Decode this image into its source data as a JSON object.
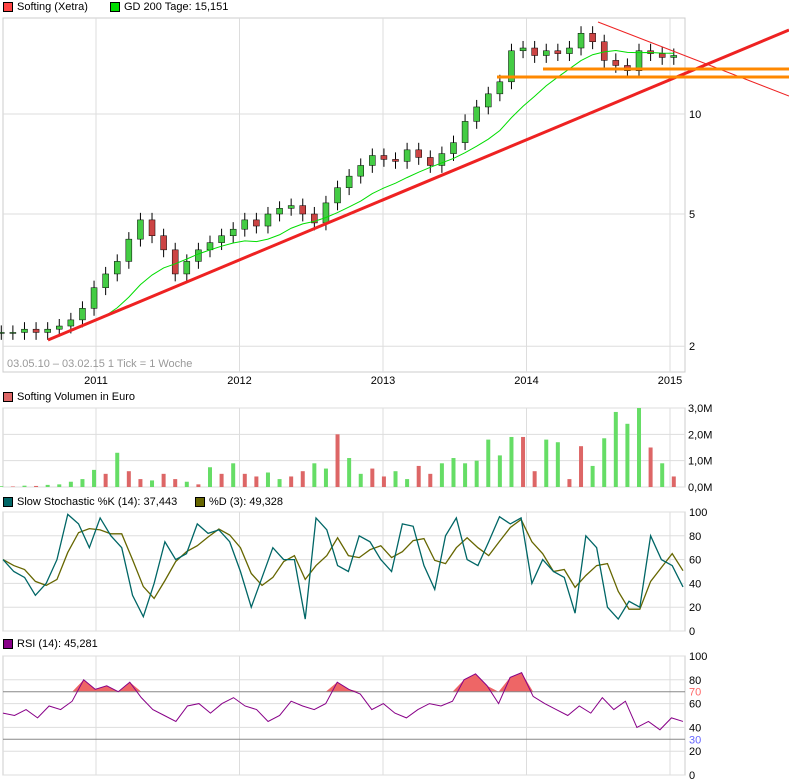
{
  "chart_data": [
    {
      "type": "candlestick",
      "name": "price",
      "legend": [
        {
          "label": "Softing (Xetra)",
          "color": "#ff4444"
        },
        {
          "label": "GD 200 Tage: 15,151",
          "color": "#00dd00"
        }
      ],
      "info": "03.05.10 – 03.02.15   1 Tick = 1 Woche",
      "yscale": "log",
      "ylim": [
        1.75,
        19.5
      ],
      "yticks": [
        {
          "v": 2,
          "l": "2"
        },
        {
          "v": 5,
          "l": "5"
        },
        {
          "v": 10,
          "l": "10"
        }
      ],
      "xticks": [
        {
          "v": 2011,
          "l": "2011"
        },
        {
          "v": 2012,
          "l": "2012"
        },
        {
          "v": 2013,
          "l": "2013"
        },
        {
          "v": 2014,
          "l": "2014"
        },
        {
          "v": 2015,
          "l": "2015"
        }
      ],
      "x_start": 2010.34,
      "x_step": 0.0808,
      "close": [
        2.2,
        2.2,
        2.25,
        2.2,
        2.25,
        2.3,
        2.4,
        2.6,
        3.0,
        3.3,
        3.6,
        4.2,
        4.8,
        4.3,
        3.9,
        3.3,
        3.6,
        3.9,
        4.1,
        4.3,
        4.5,
        4.8,
        4.6,
        5.0,
        5.2,
        5.3,
        5.0,
        4.7,
        5.4,
        6.0,
        6.5,
        7.0,
        7.5,
        7.3,
        7.2,
        7.8,
        7.4,
        7.0,
        7.6,
        8.2,
        9.5,
        10.5,
        11.5,
        12.5,
        15.5,
        15.8,
        15.0,
        15.5,
        15.2,
        15.8,
        17.5,
        16.5,
        14.5,
        14.0,
        13.5,
        15.5,
        15.2,
        14.8,
        15.0
      ],
      "ma_color": "#00dd00"
    },
    {
      "type": "bar",
      "name": "volume",
      "legend": [
        {
          "label": "Softing Volumen in Euro",
          "color": "#dd6666"
        }
      ],
      "ylim": [
        0,
        3
      ],
      "yticks": [
        {
          "v": 0,
          "l": "0,0M"
        },
        {
          "v": 1,
          "l": "1,0M"
        },
        {
          "v": 2,
          "l": "2,0M"
        },
        {
          "v": 3,
          "l": "3,0M"
        }
      ],
      "values": [
        0.03,
        0.02,
        0.05,
        0.04,
        0.08,
        0.1,
        0.2,
        0.3,
        0.65,
        0.5,
        1.3,
        0.6,
        0.3,
        0.25,
        0.5,
        0.3,
        0.2,
        0.1,
        0.75,
        0.5,
        0.9,
        0.5,
        0.4,
        0.55,
        0.3,
        0.4,
        0.6,
        0.9,
        0.7,
        2.0,
        1.1,
        0.5,
        0.7,
        0.4,
        0.6,
        0.3,
        0.8,
        0.5,
        0.9,
        1.1,
        0.9,
        1.0,
        1.8,
        1.2,
        1.9,
        1.9,
        0.6,
        1.8,
        1.7,
        0.3,
        1.55,
        0.8,
        1.85,
        2.85,
        2.4,
        3.0,
        1.5,
        0.9,
        0.4
      ],
      "up": [
        1,
        0,
        1,
        0,
        1,
        1,
        1,
        1,
        1,
        0,
        1,
        0,
        0,
        1,
        0,
        0,
        1,
        0,
        1,
        0,
        1,
        0,
        0,
        1,
        1,
        0,
        0,
        1,
        1,
        0,
        1,
        1,
        0,
        0,
        1,
        1,
        0,
        0,
        1,
        1,
        1,
        1,
        1,
        1,
        1,
        0,
        0,
        1,
        1,
        0,
        0,
        1,
        1,
        1,
        1,
        1,
        0,
        1,
        0
      ],
      "up_color": "#66dd66",
      "down_color": "#dd6666"
    },
    {
      "type": "line",
      "name": "stochastic",
      "legend": [
        {
          "label": "Slow Stochastic %K (14): 37,443",
          "color": "#006666"
        },
        {
          "label": "%D (3): 49,328",
          "color": "#666600"
        }
      ],
      "ylim": [
        0,
        100
      ],
      "yticks": [
        {
          "v": 0,
          "l": "0"
        },
        {
          "v": 20,
          "l": "20"
        },
        {
          "v": 40,
          "l": "40"
        },
        {
          "v": 60,
          "l": "60"
        },
        {
          "v": 80,
          "l": "80"
        },
        {
          "v": 100,
          "l": "100"
        }
      ],
      "k": [
        60,
        50,
        45,
        30,
        40,
        60,
        98,
        90,
        70,
        95,
        80,
        70,
        30,
        12,
        40,
        75,
        60,
        65,
        90,
        82,
        85,
        75,
        50,
        20,
        45,
        70,
        60,
        60,
        10,
        95,
        85,
        55,
        50,
        80,
        75,
        60,
        50,
        90,
        88,
        55,
        35,
        80,
        95,
        60,
        55,
        75,
        96,
        90,
        95,
        40,
        60,
        50,
        45,
        15,
        80,
        70,
        20,
        10,
        25,
        20,
        80,
        60,
        55,
        37
      ],
      "k_color": "#006666",
      "d_color": "#666600"
    },
    {
      "type": "line",
      "name": "rsi",
      "legend": [
        {
          "label": "RSI (14): 45,281",
          "color": "#880088"
        }
      ],
      "ylim": [
        0,
        100
      ],
      "yticks": [
        {
          "v": 0,
          "l": "0"
        },
        {
          "v": 20,
          "l": "20"
        },
        {
          "v": 40,
          "l": "40"
        },
        {
          "v": 60,
          "l": "60"
        },
        {
          "v": 80,
          "l": "80"
        },
        {
          "v": 100,
          "l": "100"
        }
      ],
      "levels": [
        {
          "v": 70,
          "l": "70",
          "color": "#ff6666"
        },
        {
          "v": 30,
          "l": "30",
          "color": "#6666ff"
        }
      ],
      "values": [
        52,
        50,
        55,
        48,
        58,
        55,
        62,
        80,
        72,
        75,
        70,
        78,
        65,
        55,
        50,
        45,
        58,
        60,
        52,
        60,
        65,
        58,
        55,
        45,
        50,
        62,
        58,
        55,
        60,
        78,
        72,
        68,
        55,
        60,
        52,
        48,
        55,
        60,
        58,
        62,
        80,
        85,
        75,
        60,
        82,
        86,
        66,
        60,
        55,
        50,
        58,
        52,
        65,
        55,
        62,
        40,
        45,
        38,
        48,
        45
      ]
    }
  ]
}
